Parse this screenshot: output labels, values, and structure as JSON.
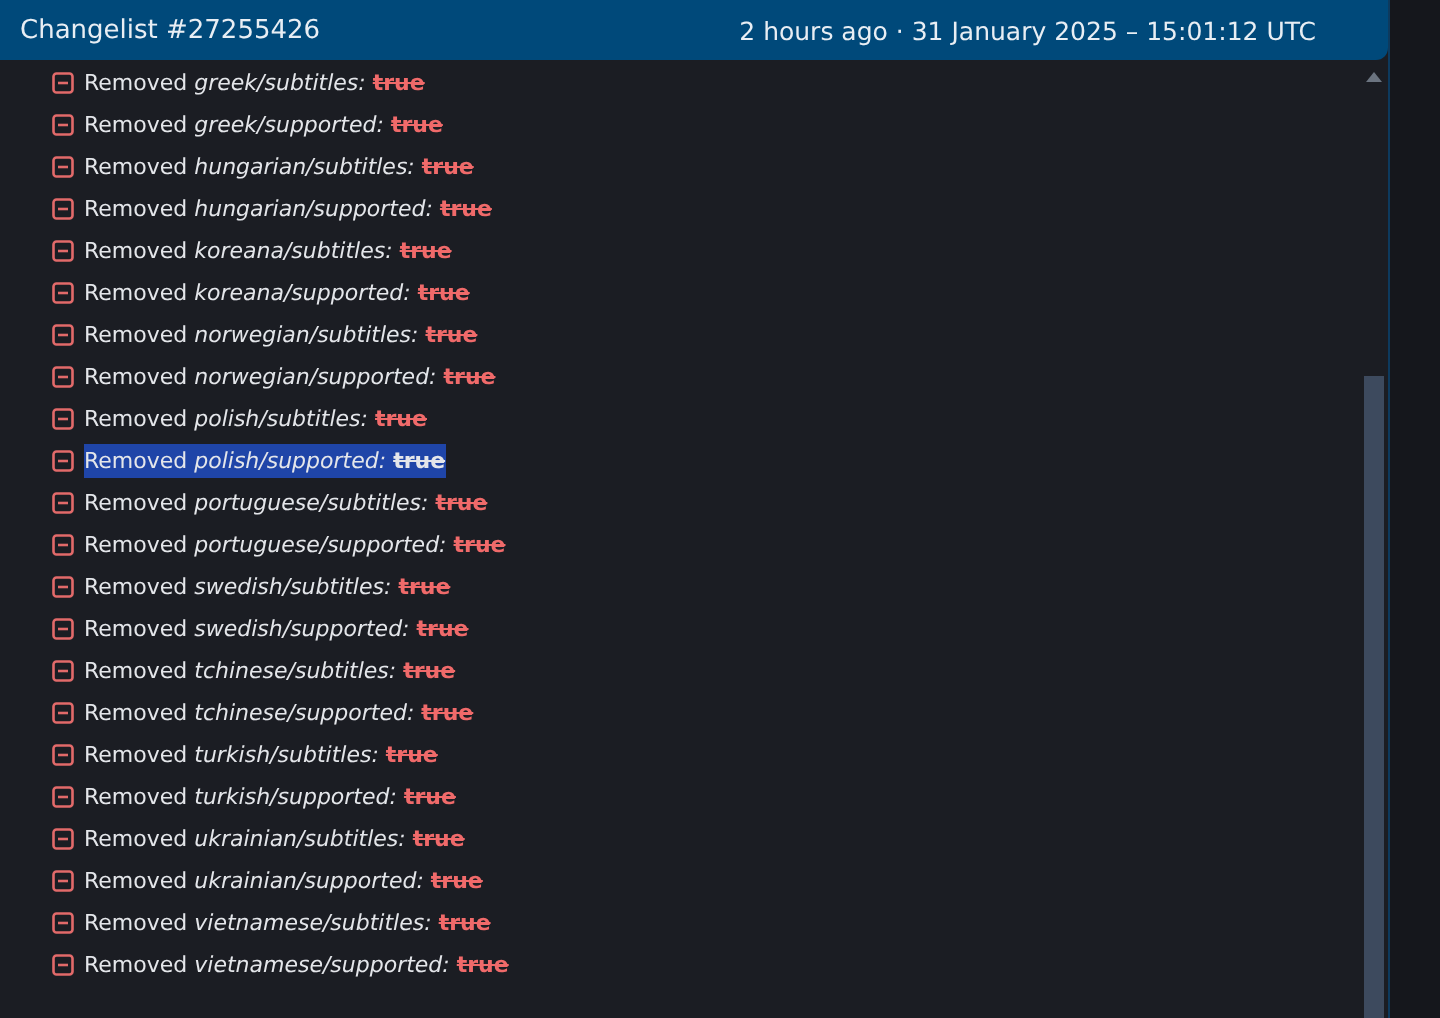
{
  "header": {
    "title": "Changelist #27255426",
    "timestamp": "2 hours ago · 31 January 2025 – 15:01:12 UTC"
  },
  "changes": [
    {
      "action": "Removed",
      "path": "greek/subtitles:",
      "value": "true",
      "selected": false
    },
    {
      "action": "Removed",
      "path": "greek/supported:",
      "value": "true",
      "selected": false
    },
    {
      "action": "Removed",
      "path": "hungarian/subtitles:",
      "value": "true",
      "selected": false
    },
    {
      "action": "Removed",
      "path": "hungarian/supported:",
      "value": "true",
      "selected": false
    },
    {
      "action": "Removed",
      "path": "koreana/subtitles:",
      "value": "true",
      "selected": false
    },
    {
      "action": "Removed",
      "path": "koreana/supported:",
      "value": "true",
      "selected": false
    },
    {
      "action": "Removed",
      "path": "norwegian/subtitles:",
      "value": "true",
      "selected": false
    },
    {
      "action": "Removed",
      "path": "norwegian/supported:",
      "value": "true",
      "selected": false
    },
    {
      "action": "Removed",
      "path": "polish/subtitles:",
      "value": "true",
      "selected": false
    },
    {
      "action": "Removed",
      "path": "polish/supported:",
      "value": "true",
      "selected": true
    },
    {
      "action": "Removed",
      "path": "portuguese/subtitles:",
      "value": "true",
      "selected": false
    },
    {
      "action": "Removed",
      "path": "portuguese/supported:",
      "value": "true",
      "selected": false
    },
    {
      "action": "Removed",
      "path": "swedish/subtitles:",
      "value": "true",
      "selected": false
    },
    {
      "action": "Removed",
      "path": "swedish/supported:",
      "value": "true",
      "selected": false
    },
    {
      "action": "Removed",
      "path": "tchinese/subtitles:",
      "value": "true",
      "selected": false
    },
    {
      "action": "Removed",
      "path": "tchinese/supported:",
      "value": "true",
      "selected": false
    },
    {
      "action": "Removed",
      "path": "turkish/subtitles:",
      "value": "true",
      "selected": false
    },
    {
      "action": "Removed",
      "path": "turkish/supported:",
      "value": "true",
      "selected": false
    },
    {
      "action": "Removed",
      "path": "ukrainian/subtitles:",
      "value": "true",
      "selected": false
    },
    {
      "action": "Removed",
      "path": "ukrainian/supported:",
      "value": "true",
      "selected": false
    },
    {
      "action": "Removed",
      "path": "vietnamese/subtitles:",
      "value": "true",
      "selected": false
    },
    {
      "action": "Removed",
      "path": "vietnamese/supported:",
      "value": "true",
      "selected": false
    }
  ]
}
